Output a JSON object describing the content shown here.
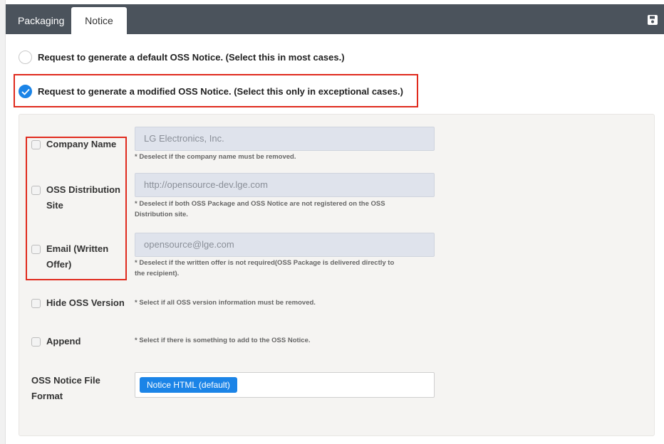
{
  "tabs": {
    "packaging": "Packaging",
    "notice": "Notice"
  },
  "toolbar": {
    "save_icon": "save-icon"
  },
  "notice_options": {
    "default": "Request to generate a default OSS Notice. (Select this in most cases.)",
    "modified": "Request to generate a modified OSS Notice. (Select this only in exceptional cases.)",
    "selected": "modified"
  },
  "fields": {
    "company_name": {
      "label": "Company Name",
      "value": "LG Electronics, Inc.",
      "hint": "* Deselect if the company name must be removed.",
      "checked": false
    },
    "distribution_site": {
      "label_line1": "OSS Distribution",
      "label_line2": "Site",
      "value": "http://opensource-dev.lge.com",
      "hint_line1": "* Deselect if both OSS Package and OSS Notice are not registered on the OSS",
      "hint_line2": "Distribution site.",
      "checked": false
    },
    "email": {
      "label_line1": "Email (Written",
      "label_line2": "Offer)",
      "value": "opensource@lge.com",
      "hint_line1": "* Deselect if the written offer is not required(OSS Package is delivered directly to",
      "hint_line2": "the recipient).",
      "checked": false
    },
    "hide_version": {
      "label": "Hide OSS Version",
      "hint": "* Select if all OSS version information must be removed.",
      "checked": false
    },
    "append": {
      "label": "Append",
      "hint": "* Select if there is something to add to the OSS Notice.",
      "checked": false
    }
  },
  "file_format": {
    "label_line1": "OSS Notice File",
    "label_line2": "Format",
    "selected": "Notice HTML (default)"
  },
  "colors": {
    "accent": "#1b84e7",
    "tabbar": "#4b535c",
    "highlight": "#e02a1d"
  }
}
